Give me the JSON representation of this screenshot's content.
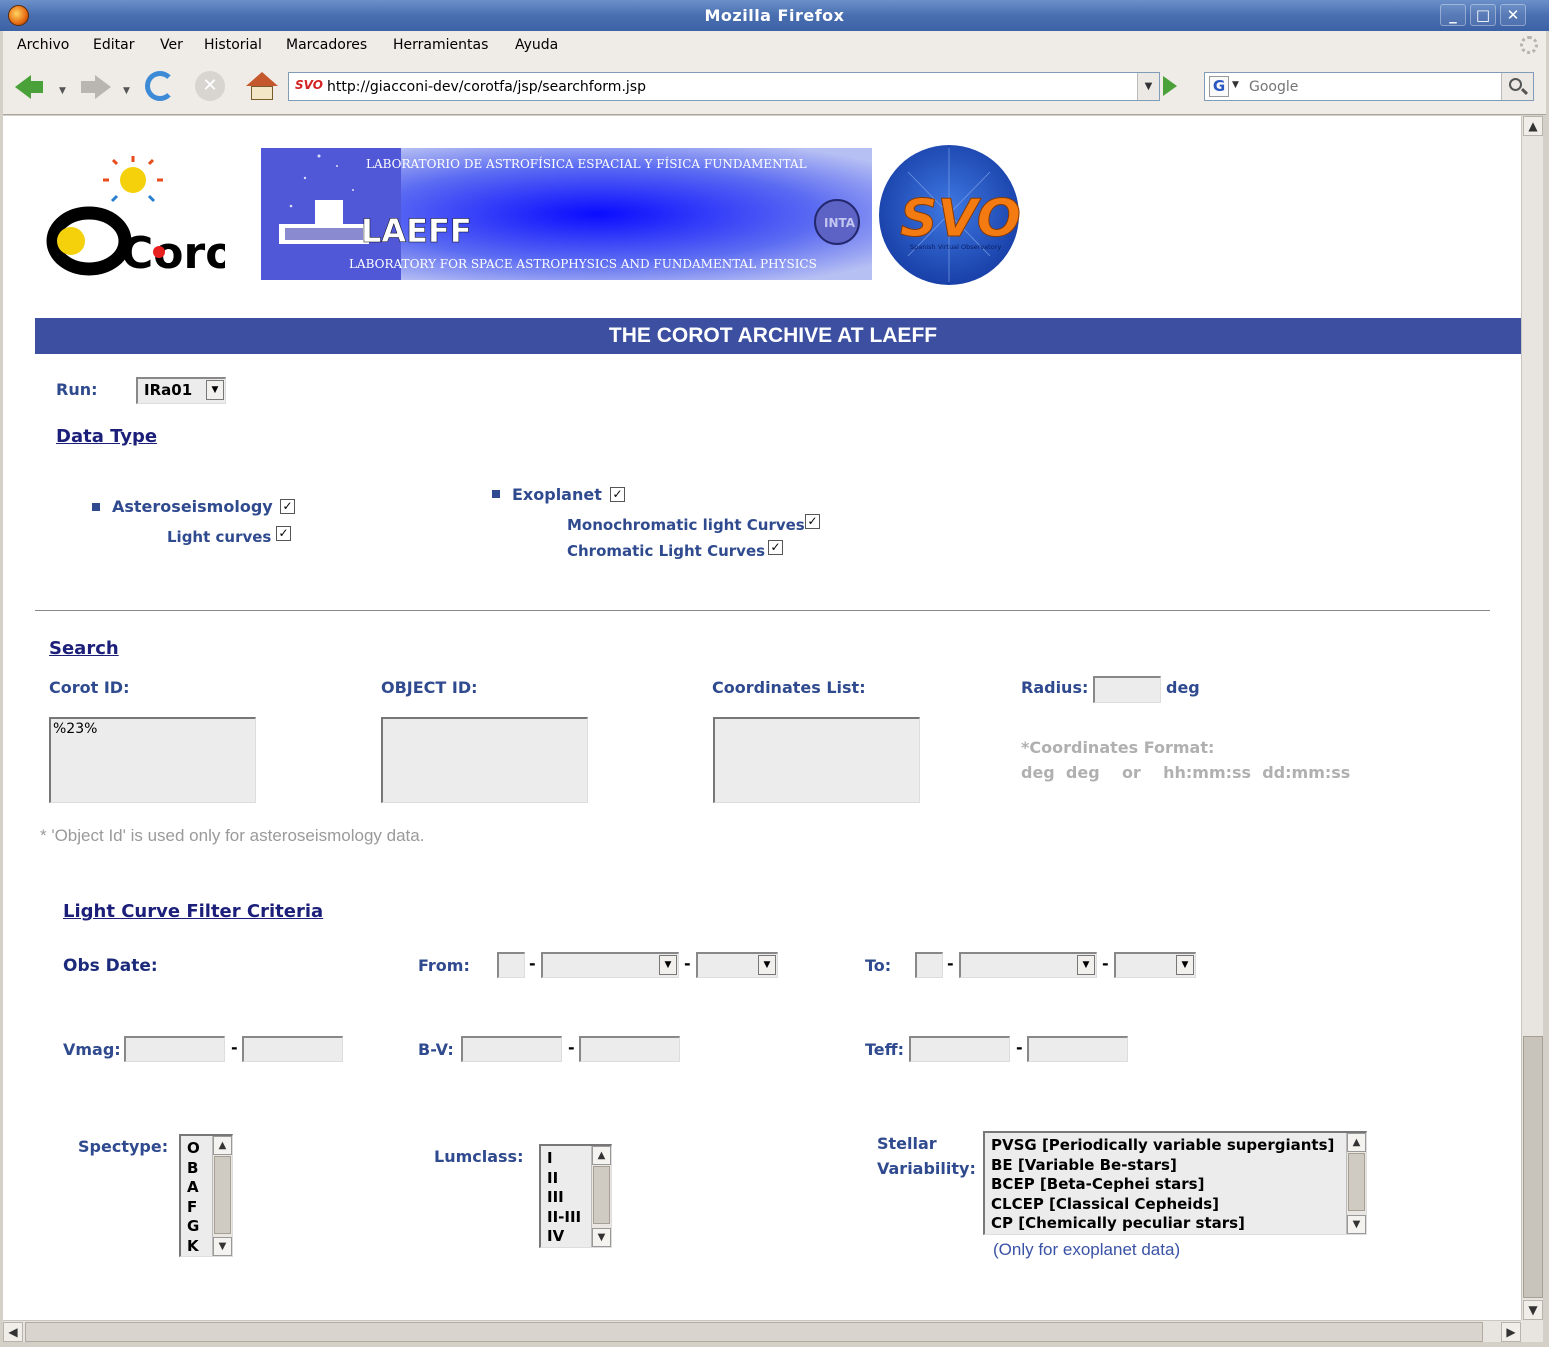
{
  "window": {
    "title": "Mozilla Firefox",
    "buttons": [
      "_",
      "□",
      "✕"
    ]
  },
  "menu": [
    "Archivo",
    "Editar",
    "Ver",
    "Historial",
    "Marcadores",
    "Herramientas",
    "Ayuda"
  ],
  "nav": {
    "url": "http://giacconi-dev/corotfa/jsp/searchform.jsp",
    "url_icon": "SVO",
    "search_placeholder": "Google",
    "search_engine_letter": "G"
  },
  "header": {
    "corot_logo_text": "Corot",
    "laeff_top": "LABORATORIO DE ASTROFÍSICA ESPACIAL Y FÍSICA FUNDAMENTAL",
    "laeff_name": "LAEFF",
    "laeff_bottom": "LABORATORY FOR SPACE ASTROPHYSICS AND FUNDAMENTAL PHYSICS",
    "inta": "INTA",
    "svo": "SVO",
    "svo_sub": "Spanish Virtual Observatory",
    "title": "THE COROT ARCHIVE AT LAEFF"
  },
  "run": {
    "label": "Run:",
    "value": "IRa01"
  },
  "datatype": {
    "heading": "Data Type",
    "astero": "Asteroseismology",
    "astero_lc": "Light curves",
    "exo": "Exoplanet",
    "mono": "Monochromatic light Curves",
    "chrom": "Chromatic Light Curves"
  },
  "search": {
    "heading": "Search",
    "corot_label": "Corot ID:",
    "corot_value": "%23%",
    "object_label": "OBJECT ID:",
    "coords_label": "Coordinates List:",
    "radius_label": "Radius:",
    "radius_unit": "deg",
    "coord_fmt_title": "*Coordinates Format:",
    "coord_fmt": "deg  deg    or    hh:mm:ss  dd:mm:ss",
    "note": "* 'Object Id' is used only for asteroseismology data."
  },
  "filter": {
    "heading": "Light Curve Filter Criteria",
    "obs_date": "Obs Date:",
    "from": "From:",
    "to": "To:",
    "dash": "-",
    "vmag": "Vmag:",
    "bv": "B-V:",
    "teff": "Teff:",
    "spectype": "Spectype:",
    "spectype_opts": [
      "O",
      "B",
      "A",
      "F",
      "G",
      "K"
    ],
    "lumclass": "Lumclass:",
    "lumclass_opts": [
      "I",
      "II",
      "III",
      "II-III",
      "IV"
    ],
    "stellar1": "Stellar",
    "stellar2": "Variability:",
    "var_opts": [
      "PVSG [Periodically variable supergiants]",
      "BE [Variable Be-stars]",
      "BCEP [Beta-Cephei stars]",
      "CLCEP [Classical Cepheids]",
      "CP [Chemically peculiar stars]"
    ],
    "exo_note": "(Only for exoplanet data)"
  }
}
